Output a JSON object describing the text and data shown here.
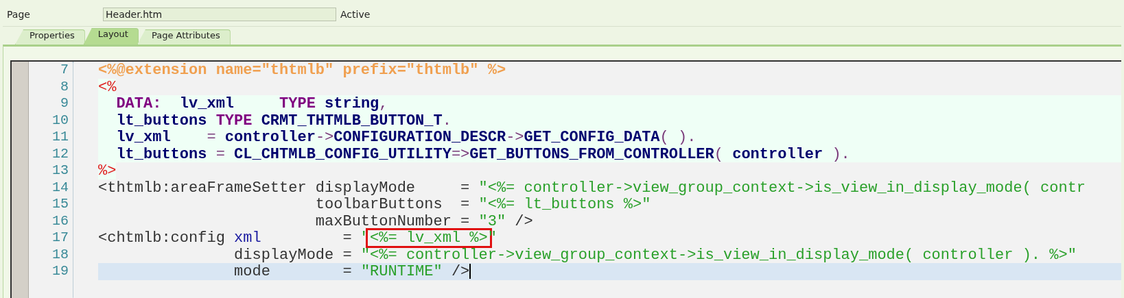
{
  "header": {
    "label": "Page",
    "field_value": "Header.htm",
    "status": "Active"
  },
  "tabs": [
    {
      "label": "Properties",
      "selected": false
    },
    {
      "label": "Layout",
      "selected": true
    },
    {
      "label": "Page Attributes",
      "selected": false
    }
  ],
  "editor": {
    "lines": [
      {
        "number": "7",
        "kind": "normal",
        "tokens": [
          {
            "kind": "directive",
            "text": "<%@extension name=\"thtmlb\" prefix=\"thtmlb\" %>"
          }
        ]
      },
      {
        "number": "8",
        "kind": "normal",
        "tokens": [
          {
            "kind": "delim",
            "text": "<%"
          }
        ]
      },
      {
        "number": "9",
        "kind": "abap",
        "tokens": [
          {
            "kind": "keyword",
            "text": "  DATA:"
          },
          {
            "kind": "ident",
            "text": "  lv_xml     "
          },
          {
            "kind": "keyword",
            "text": "TYPE"
          },
          {
            "kind": "ident",
            "text": " string"
          },
          {
            "kind": "op",
            "text": ","
          }
        ]
      },
      {
        "number": "10",
        "kind": "abap",
        "tokens": [
          {
            "kind": "ident",
            "text": "  lt_buttons "
          },
          {
            "kind": "keyword",
            "text": "TYPE"
          },
          {
            "kind": "ident",
            "text": " CRMT_THTMLB_BUTTON_T"
          },
          {
            "kind": "op",
            "text": "."
          }
        ]
      },
      {
        "number": "11",
        "kind": "abap",
        "tokens": [
          {
            "kind": "ident",
            "text": "  lv_xml    "
          },
          {
            "kind": "op",
            "text": "="
          },
          {
            "kind": "ident",
            "text": " controller"
          },
          {
            "kind": "op",
            "text": "->"
          },
          {
            "kind": "ident",
            "text": "CONFIGURATION_DESCR"
          },
          {
            "kind": "op",
            "text": "->"
          },
          {
            "kind": "ident",
            "text": "GET_CONFIG_DATA"
          },
          {
            "kind": "op",
            "text": "( )."
          }
        ]
      },
      {
        "number": "12",
        "kind": "abap",
        "tokens": [
          {
            "kind": "ident",
            "text": "  lt_buttons "
          },
          {
            "kind": "op",
            "text": "="
          },
          {
            "kind": "ident",
            "text": " CL_CHTMLB_CONFIG_UTILITY"
          },
          {
            "kind": "op",
            "text": "=>"
          },
          {
            "kind": "ident",
            "text": "GET_BUTTONS_FROM_CONTROLLER"
          },
          {
            "kind": "op",
            "text": "( "
          },
          {
            "kind": "ident",
            "text": "controller"
          },
          {
            "kind": "op",
            "text": " )."
          }
        ]
      },
      {
        "number": "13",
        "kind": "normal",
        "tokens": [
          {
            "kind": "delim",
            "text": "%>"
          }
        ]
      },
      {
        "number": "14",
        "kind": "normal",
        "tokens": [
          {
            "kind": "tag",
            "text": "<thtmlb:areaFrameSetter displayMode     = "
          },
          {
            "kind": "string",
            "text": "\"<%= controller->view_group_context->is_view_in_display_mode( contr"
          }
        ]
      },
      {
        "number": "15",
        "kind": "normal",
        "tokens": [
          {
            "kind": "tag",
            "text": "                        toolbarButtons  = "
          },
          {
            "kind": "string",
            "text": "\"<%= lt_buttons %>\""
          }
        ]
      },
      {
        "number": "16",
        "kind": "normal",
        "tokens": [
          {
            "kind": "tag",
            "text": "                        maxButtonNumber = "
          },
          {
            "kind": "string",
            "text": "\"3\""
          },
          {
            "kind": "tag",
            "text": " />"
          }
        ]
      },
      {
        "number": "17",
        "kind": "normal",
        "tokens": [
          {
            "kind": "tag",
            "text": "<chtmlb:config "
          },
          {
            "kind": "attr",
            "text": "xml"
          },
          {
            "kind": "tag",
            "text": "         = "
          },
          {
            "kind": "string",
            "text": "\""
          },
          {
            "kind": "marked",
            "text": "<%= lv_xml %>"
          },
          {
            "kind": "string",
            "text": "\""
          }
        ]
      },
      {
        "number": "18",
        "kind": "normal",
        "tokens": [
          {
            "kind": "tag",
            "text": "               displayMode = "
          },
          {
            "kind": "string",
            "text": "\"<%= controller->view_group_context->is_view_in_display_mode( controller ). %>\""
          }
        ]
      },
      {
        "number": "19",
        "kind": "current",
        "tokens": [
          {
            "kind": "tag",
            "text": "               mode        = "
          },
          {
            "kind": "string",
            "text": "\"RUNTIME\""
          },
          {
            "kind": "tag",
            "text": " />"
          }
        ]
      }
    ]
  }
}
